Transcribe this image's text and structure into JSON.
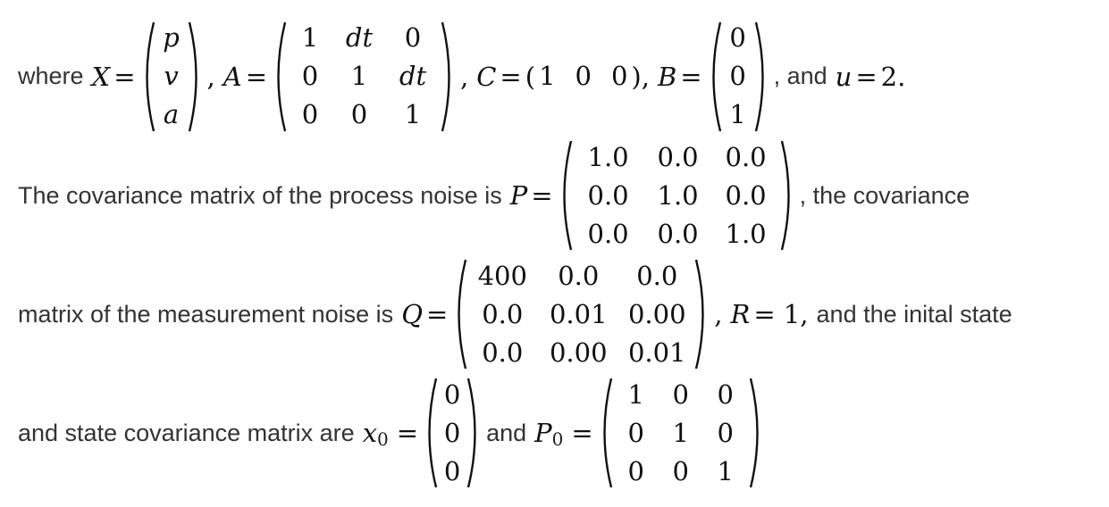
{
  "line1": {
    "where": "where",
    "X": "X",
    "eq": "=",
    "X_vec": [
      "p",
      "v",
      "a"
    ],
    "comma": ",",
    "A": "A",
    "A_mat": [
      [
        "1",
        "dt",
        "0"
      ],
      [
        "0",
        "1",
        "dt"
      ],
      [
        "0",
        "0",
        "1"
      ]
    ],
    "C": "C",
    "C_row": [
      "1",
      "0",
      "0"
    ],
    "comma_B": "),",
    "B": "B",
    "B_vec": [
      "0",
      "0",
      "1"
    ],
    "and_u": ", and",
    "u": "u",
    "u_val": "2.",
    "lparen": "("
  },
  "line2": {
    "text": "The covariance matrix of the process noise is",
    "P": "P",
    "eq": "=",
    "P_mat": [
      [
        "1.0",
        "0.0",
        "0.0"
      ],
      [
        "0.0",
        "1.0",
        "0.0"
      ],
      [
        "0.0",
        "0.0",
        "1.0"
      ]
    ],
    "tail": ", the covariance"
  },
  "line3": {
    "text": "matrix of the measurement noise is",
    "Q": "Q",
    "eq": "=",
    "Q_mat": [
      [
        "400",
        "0.0",
        "0.0"
      ],
      [
        "0.0",
        "0.01",
        "0.00"
      ],
      [
        "0.0",
        "0.00",
        "0.01"
      ]
    ],
    "comma": ",",
    "R": "R",
    "R_eq": "= 1,",
    "tail": "and the inital state"
  },
  "line4": {
    "text": "and state covariance matrix are",
    "x": "x",
    "x_sub": "0",
    "eq": "=",
    "x0_vec": [
      "0",
      "0",
      "0"
    ],
    "and": "and",
    "P": "P",
    "P_sub": "0",
    "P0_mat": [
      [
        "1",
        "0",
        "0"
      ],
      [
        "0",
        "1",
        "0"
      ],
      [
        "0",
        "0",
        "1"
      ]
    ]
  }
}
